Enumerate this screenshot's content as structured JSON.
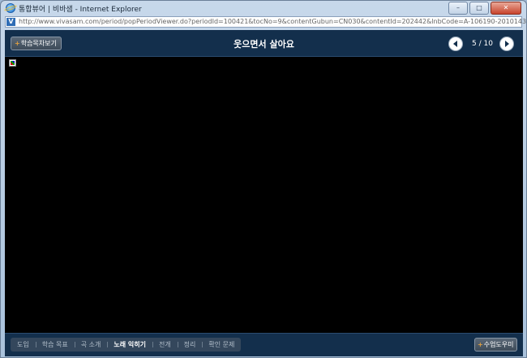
{
  "window": {
    "title": "통합뷰어 | 비바샘 - Internet Explorer",
    "minimize": "–",
    "maximize": "□",
    "close": "✕"
  },
  "address_bar": {
    "logo": "V",
    "url": "http://www.vivasam.com/period/popPeriodViewer.do?periodId=100421&tocNo=9&contentGubun=CN030&contentId=202442&lnbCode=A-106190-20101436"
  },
  "header": {
    "toc_button": {
      "plus": "+",
      "label": "학습목차보기"
    },
    "title": "웃으면서 살아요",
    "pagination": {
      "current": "5",
      "total": "10",
      "text": "5 / 10"
    }
  },
  "footer": {
    "tabs": [
      {
        "label": "도입",
        "active": false
      },
      {
        "label": "학습 목표",
        "active": false
      },
      {
        "label": "곡 소개",
        "active": false
      },
      {
        "label": "노래 익히기",
        "active": true
      },
      {
        "label": "전개",
        "active": false
      },
      {
        "label": "정리",
        "active": false
      },
      {
        "label": "확인 문제",
        "active": false
      }
    ],
    "help_button": {
      "plus": "+",
      "label": "수업도우미"
    }
  },
  "colors": {
    "nav_bg": "#132f4c",
    "content_bg": "#000000",
    "accent": "#e0a040"
  }
}
